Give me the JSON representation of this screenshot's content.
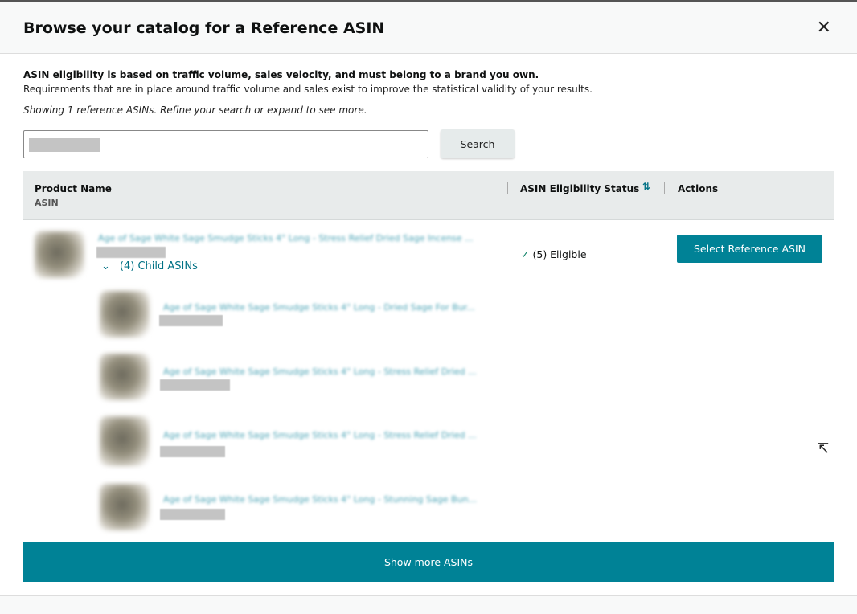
{
  "modal": {
    "title": "Browse your catalog for a Reference ASIN",
    "close_icon": "close-icon"
  },
  "intro": {
    "bold": "ASIN eligibility is based on traffic volume, sales velocity, and must belong to a brand you own.",
    "text": "Requirements that are in place around traffic volume and sales exist to improve the statistical validity of your results.",
    "showing": "Showing 1 reference ASINs. Refine your search or expand to see more."
  },
  "search": {
    "button": "Search"
  },
  "table": {
    "headers": {
      "product": "Product Name",
      "asin": "ASIN",
      "status": "ASIN Eligibility Status",
      "sort": "⇅",
      "actions": "Actions"
    },
    "parent": {
      "name": "Age of Sage White Sage Smudge Sticks 4\" Long - Stress Relief Dried Sage Incense ...",
      "child_toggle": "(4) Child ASINs",
      "status": "(5) Eligible",
      "action": "Select Reference ASIN"
    },
    "children": [
      {
        "name": "Age of Sage White Sage Smudge Sticks 4\" Long - Dried Sage For Bur..."
      },
      {
        "name": "Age of Sage White Sage Smudge Sticks 4\" Long - Stress Relief Dried ..."
      },
      {
        "name": "Age of Sage White Sage Smudge Sticks 4\" Long - Stress Relief Dried ..."
      },
      {
        "name": "Age of Sage White Sage Smudge Sticks 4\" Long - Stunning Sage Bun..."
      }
    ]
  },
  "show_more": "Show more ASINs"
}
